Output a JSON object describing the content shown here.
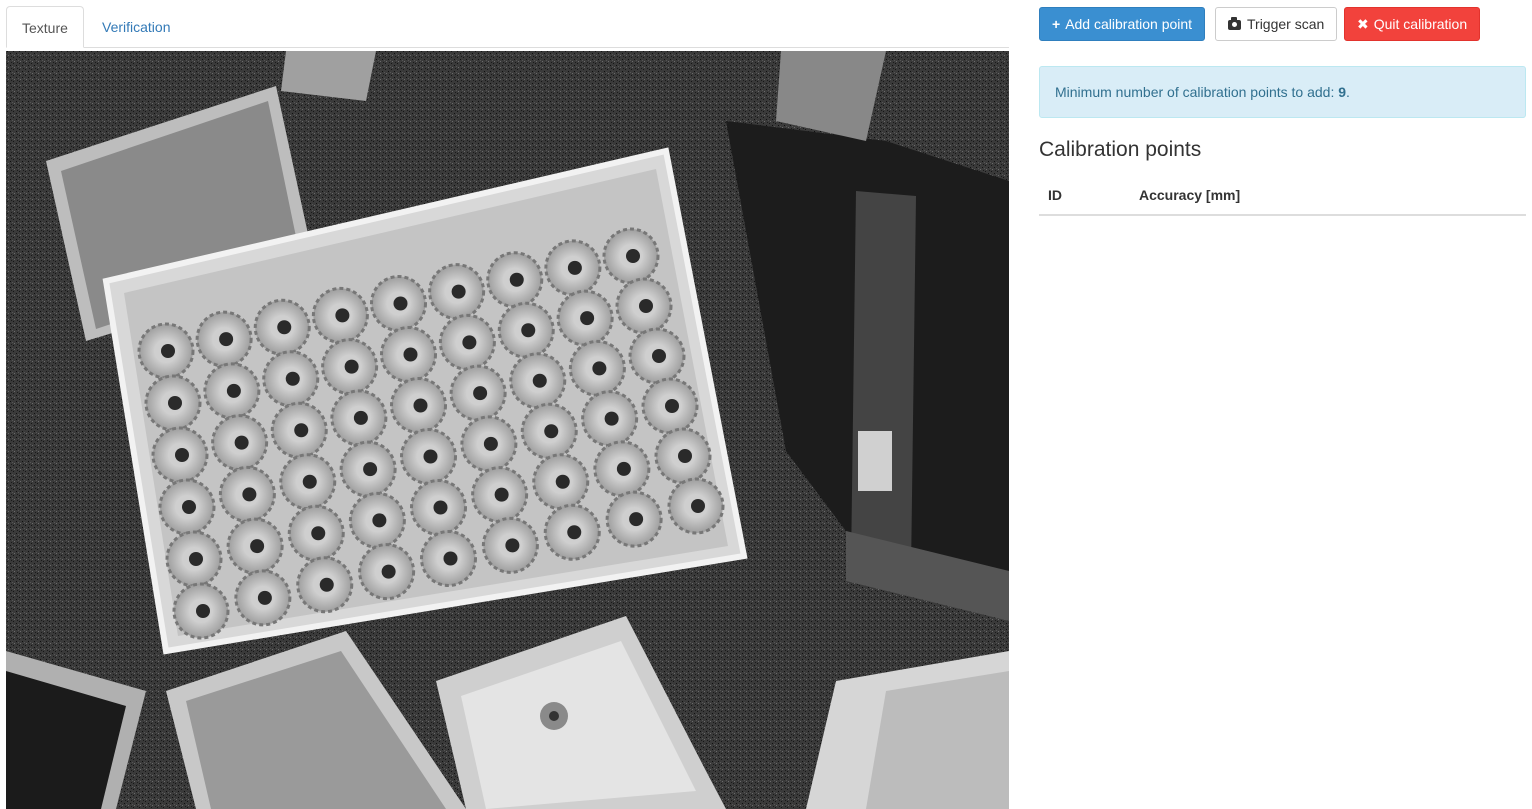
{
  "tabs": [
    {
      "label": "Texture",
      "active": true
    },
    {
      "label": "Verification",
      "active": false
    }
  ],
  "toolbar": {
    "add_label": "Add calibration point",
    "add_icon": "plus-icon",
    "scan_label": "Trigger scan",
    "scan_icon": "camera-icon",
    "quit_label": "Quit calibration",
    "quit_icon": "close-icon"
  },
  "alert": {
    "text_prefix": "Minimum number of calibration points to add: ",
    "count": "9",
    "text_suffix": "."
  },
  "calibration": {
    "title": "Calibration points",
    "columns": [
      "ID",
      "Accuracy [mm]"
    ],
    "rows": []
  },
  "colors": {
    "primary": "#3a8fd1",
    "danger": "#f2423c",
    "info_bg": "#d9edf7",
    "info_text": "#31708f",
    "link": "#337ab7"
  }
}
